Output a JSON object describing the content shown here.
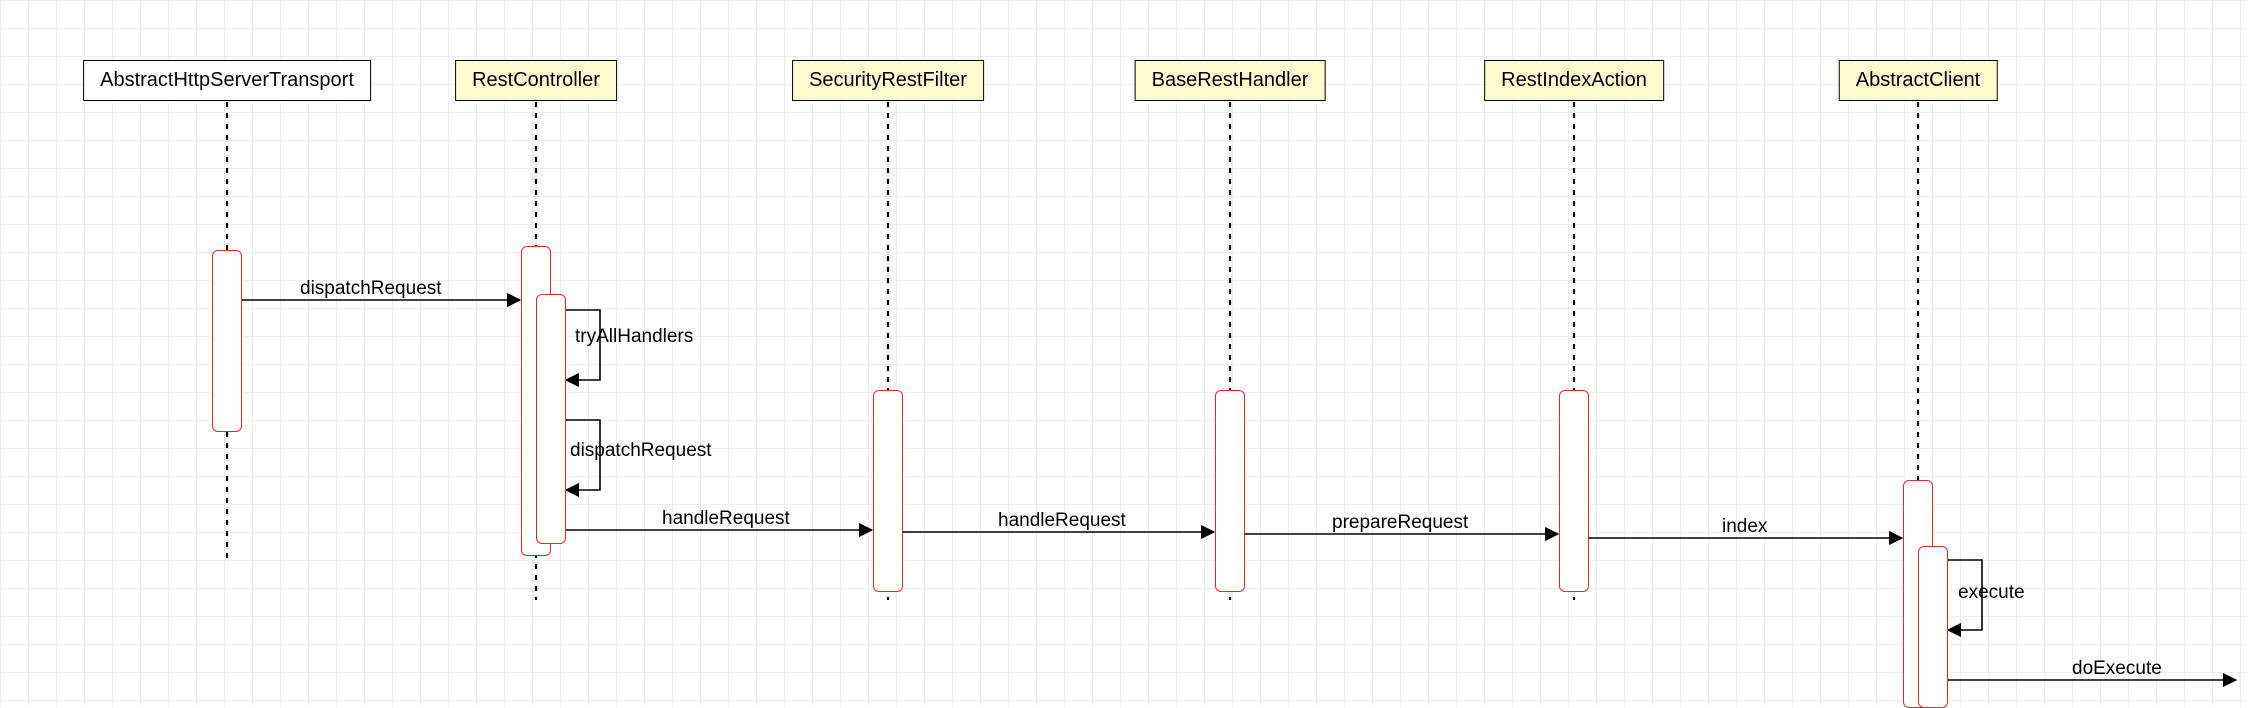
{
  "participants": {
    "p1": {
      "label": "AbstractHttpServerTransport",
      "highlight": false
    },
    "p2": {
      "label": "RestController",
      "highlight": true
    },
    "p3": {
      "label": "SecurityRestFilter",
      "highlight": true
    },
    "p4": {
      "label": "BaseRestHandler",
      "highlight": true
    },
    "p5": {
      "label": "RestIndexAction",
      "highlight": true
    },
    "p6": {
      "label": "AbstractClient",
      "highlight": true
    }
  },
  "messages": {
    "m1": {
      "label": "dispatchRequest"
    },
    "m2": {
      "label": "tryAllHandlers"
    },
    "m3": {
      "label": "dispatchRequest"
    },
    "m4": {
      "label": "handleRequest"
    },
    "m5": {
      "label": "handleRequest"
    },
    "m6": {
      "label": "prepareRequest"
    },
    "m7": {
      "label": "index"
    },
    "m8": {
      "label": "execute"
    },
    "m9": {
      "label": "doExecute"
    }
  }
}
